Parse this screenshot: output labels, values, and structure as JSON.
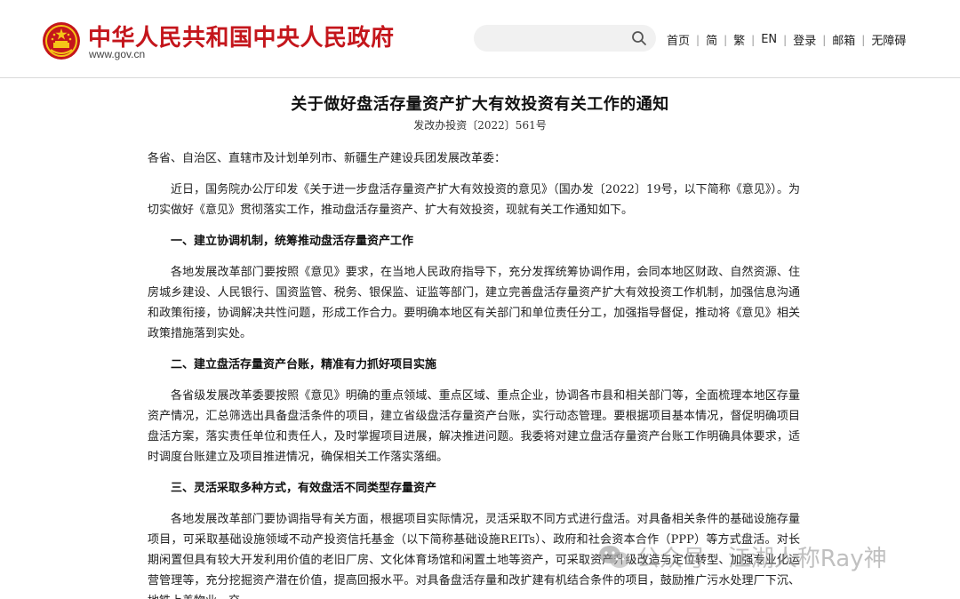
{
  "header": {
    "site_title": "中华人民共和国中央人民政府",
    "site_url": "www.gov.cn",
    "search_placeholder": "",
    "nav": [
      "首页",
      "简",
      "繁",
      "EN",
      "登录",
      "邮箱",
      "无障碍"
    ]
  },
  "document": {
    "title": "关于做好盘活存量资产扩大有效投资有关工作的通知",
    "number": "发改办投资〔2022〕561号",
    "salutation": "各省、自治区、直辖市及计划单列市、新疆生产建设兵团发展改革委：",
    "intro": "近日，国务院办公厅印发《关于进一步盘活存量资产扩大有效投资的意见》（国办发〔2022〕19号，以下简称《意见》）。为切实做好《意见》贯彻落实工作，推动盘活存量资产、扩大有效投资，现就有关工作通知如下。",
    "section1_heading": "一、建立协调机制，统筹推动盘活存量资产工作",
    "section1_text": "各地发展改革部门要按照《意见》要求，在当地人民政府指导下，充分发挥统筹协调作用，会同本地区财政、自然资源、住房城乡建设、人民银行、国资监管、税务、银保监、证监等部门，建立完善盘活存量资产扩大有效投资工作机制，加强信息沟通和政策衔接，协调解决共性问题，形成工作合力。要明确本地区有关部门和单位责任分工，加强指导督促，推动将《意见》相关政策措施落到实处。",
    "section2_heading": "二、建立盘活存量资产台账，精准有力抓好项目实施",
    "section2_text": "各省级发展改革委要按照《意见》明确的重点领域、重点区域、重点企业，协调各市县和相关部门等，全面梳理本地区存量资产情况，汇总筛选出具备盘活条件的项目，建立省级盘活存量资产台账，实行动态管理。要根据项目基本情况，督促明确项目盘活方案，落实责任单位和责任人，及时掌握项目进展，解决推进问题。我委将对建立盘活存量资产台账工作明确具体要求，适时调度台账建立及项目推进情况，确保相关工作落实落细。",
    "section3_heading": "三、灵活采取多种方式，有效盘活不同类型存量资产",
    "section3_text": "各地发展改革部门要协调指导有关方面，根据项目实际情况，灵活采取不同方式进行盘活。对具备相关条件的基础设施存量项目，可采取基础设施领域不动产投资信托基金（以下简称基础设施REITs）、政府和社会资本合作（PPP）等方式盘活。对长期闲置但具有较大开发利用价值的老旧厂房、文化体育场馆和闲置土地等资产，可采取资产升级改造与定位转型、加强专业化运营管理等，充分挖掘资产潜在价值，提高回报水平。对具备盘活存量和改扩建有机结合条件的项目，鼓励推广污水处理厂下沉、地铁上盖物业、交"
  },
  "watermark": {
    "text": "公众号 · 江湖人称Ray神",
    "color": "#8c8c8c"
  },
  "colors": {
    "brand_red": "#c4161c",
    "emblem_gold": "#f5c518"
  }
}
